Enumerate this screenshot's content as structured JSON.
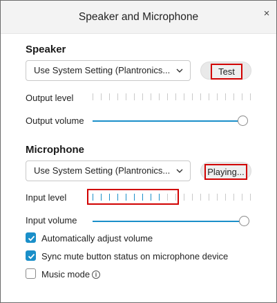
{
  "window": {
    "title": "Speaker and Microphone",
    "close_glyph": "×"
  },
  "speaker": {
    "heading": "Speaker",
    "device": "Use System Setting (Plantronics...",
    "test_label": "Test",
    "output_level_label": "Output level",
    "output_level_active_ticks": 0,
    "output_volume_label": "Output volume",
    "output_volume_fraction": 1.0
  },
  "microphone": {
    "heading": "Microphone",
    "device": "Use System Setting (Plantronics...",
    "test_label": "Playing...",
    "input_level_label": "Input level",
    "input_level_active_ticks": 9,
    "input_volume_label": "Input volume",
    "input_volume_fraction": 1.0
  },
  "options": {
    "auto_adjust": {
      "label": "Automatically adjust volume",
      "checked": true
    },
    "sync_mute": {
      "label": "Sync mute button status on microphone device",
      "checked": true
    },
    "music_mode": {
      "label": "Music mode",
      "checked": false,
      "info_glyph": "i"
    }
  },
  "colors": {
    "accent": "#1a8fc9",
    "highlight": "#d10000",
    "tick_off": "#c9c9c9"
  },
  "icons": {
    "close": "close-icon",
    "dropdown": "chevron-down-icon",
    "check": "checkmark-icon",
    "info": "info-icon"
  }
}
